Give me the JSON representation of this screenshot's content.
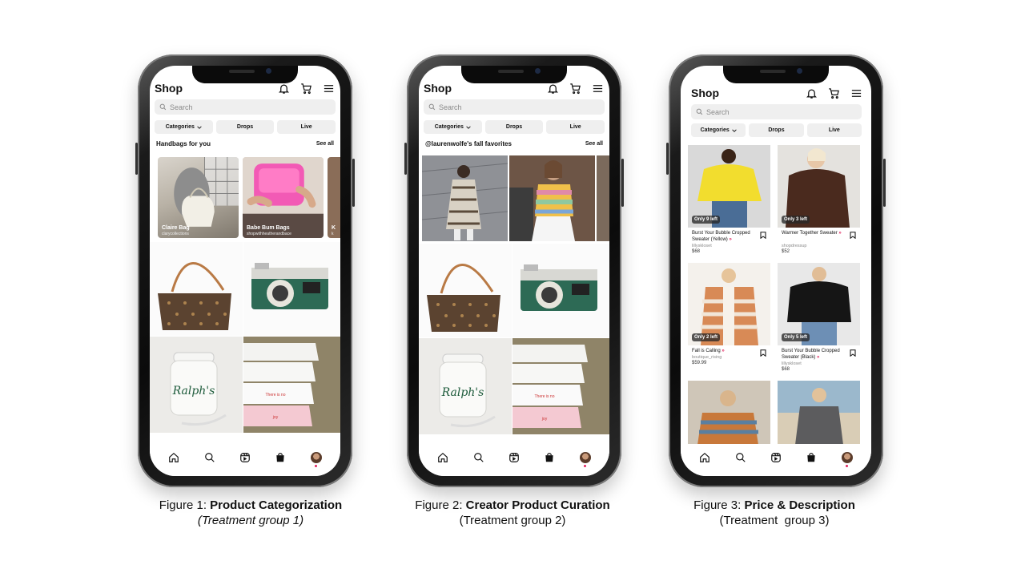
{
  "app": {
    "title": "Shop",
    "search_placeholder": "Search",
    "chips": [
      "Categories",
      "Drops",
      "Live"
    ],
    "see_all": "See all",
    "icons": [
      "bell-icon",
      "cart-icon",
      "menu-icon",
      "search-icon"
    ],
    "bottom_nav": [
      "home-icon",
      "search-icon",
      "reels-icon",
      "shop-bag-icon",
      "profile-avatar"
    ]
  },
  "phone1": {
    "section_title": "Handbags for you",
    "collections": [
      {
        "label": "Claire Bag",
        "sub": "clarycollections"
      },
      {
        "label": "Babe Bum Bags",
        "sub": "shopwithheatherandbace"
      },
      {
        "label": "K",
        "sub": "k"
      }
    ]
  },
  "phone2": {
    "section_title": "@laurenwolfe's fall favorites"
  },
  "phone3": {
    "products": [
      {
        "badge": "Only 9 left",
        "name": "Burst Your Bubble Cropped Sweater (Yellow)",
        "seller": "lillyskloset",
        "price": "$68"
      },
      {
        "badge": "Only 3 left",
        "name": "Warmer Together Sweater",
        "seller": "shopdressup",
        "price": "$52"
      },
      {
        "badge": "Only 2 left",
        "name": "Fall is Calling",
        "seller": "boutique_rising",
        "price": "$59.99"
      },
      {
        "badge": "Only 5 left",
        "name": "Burst Your Bubble Cropped Sweater (Black)",
        "seller": "lillyskloset",
        "price": "$68"
      }
    ]
  },
  "captions": [
    {
      "prefix": "Figure 1: ",
      "bold": "Product Categorization",
      "sub": "(Treatment group 1)"
    },
    {
      "prefix": "Figure 2: ",
      "bold": "Creator Product Curation",
      "sub": "(Treatment group 2)"
    },
    {
      "prefix": "Figure 3: ",
      "bold": "Price & Description",
      "sub": "(Treatment  group 3)"
    }
  ],
  "colors": {
    "accent": "#e0245e",
    "chip_bg": "#efefef"
  }
}
